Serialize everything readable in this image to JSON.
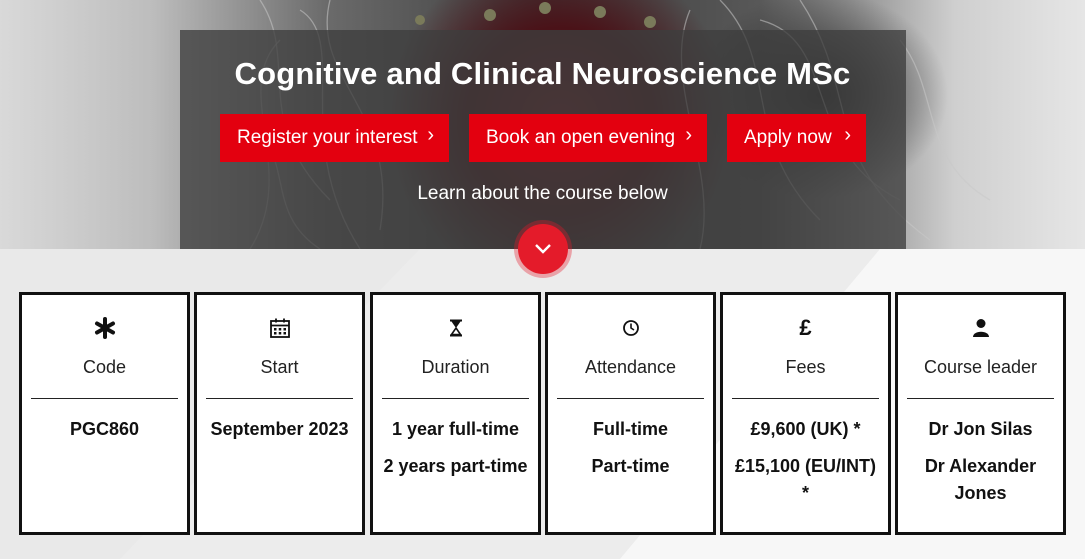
{
  "hero": {
    "title": "Cognitive and Clinical Neuroscience MSc",
    "buttons": [
      {
        "label": "Register your interest",
        "icon": "chevron-right-icon"
      },
      {
        "label": "Book an open evening",
        "icon": "chevron-right-icon"
      },
      {
        "label": "Apply now",
        "icon": "chevron-right-icon"
      }
    ],
    "learn_more": "Learn about the course below",
    "scroll_icon": "chevron-down-icon"
  },
  "colors": {
    "accent": "#e3000f",
    "card_border": "#111111",
    "page_background": "#ececec"
  },
  "cards": [
    {
      "icon": "asterisk-icon",
      "label": "Code",
      "values": [
        "PGC860"
      ]
    },
    {
      "icon": "calendar-icon",
      "label": "Start",
      "values": [
        "September 2023"
      ]
    },
    {
      "icon": "hourglass-icon",
      "label": "Duration",
      "values": [
        "1 year full-time",
        "2 years part-time"
      ]
    },
    {
      "icon": "clock-icon",
      "label": "Attendance",
      "values": [
        "Full-time",
        "Part-time"
      ]
    },
    {
      "icon": "pound-icon",
      "label": "Fees",
      "values": [
        "£9,600 (UK) *",
        "£15,100 (EU/INT) *"
      ]
    },
    {
      "icon": "person-icon",
      "label": "Course leader",
      "values": [
        "Dr Jon Silas",
        "Dr Alexander Jones"
      ]
    }
  ]
}
